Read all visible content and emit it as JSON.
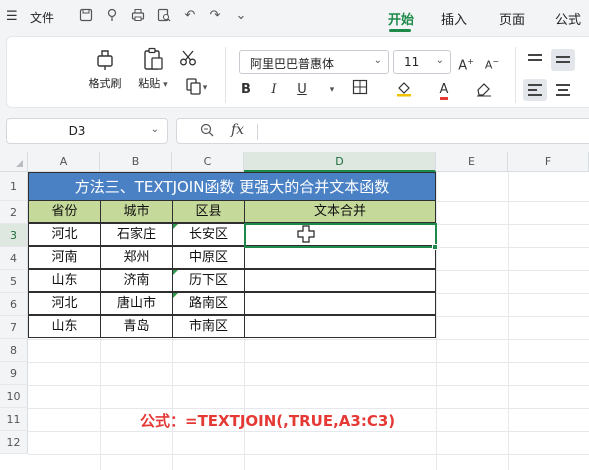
{
  "menubar": {
    "file_label": "文件",
    "tabs": [
      {
        "label": "开始",
        "active": true
      },
      {
        "label": "插入",
        "active": false
      },
      {
        "label": "页面",
        "active": false
      },
      {
        "label": "公式",
        "active": false
      }
    ],
    "accent_color": "#1e8a4a"
  },
  "ribbon": {
    "format_painter_label": "格式刷",
    "paste_label": "粘贴",
    "font_name": "阿里巴巴普惠体",
    "font_size": "11",
    "bold_label": "B",
    "italic_label": "I",
    "underline_label": "U"
  },
  "formula_bar": {
    "name_box": "D3",
    "fx_label": "fx",
    "formula": ""
  },
  "grid": {
    "columns": [
      "A",
      "B",
      "C",
      "D",
      "E",
      "F"
    ],
    "selected_column": "D",
    "rows": [
      "1",
      "2",
      "3",
      "4",
      "5",
      "6",
      "7",
      "8",
      "9",
      "10",
      "11",
      "12"
    ],
    "selected_row": "3",
    "title": "方法三、TEXTJOIN函数 更强大的合并文本函数",
    "title_color": "#4a80c4",
    "header_color": "#c5d99a",
    "headers": [
      "省份",
      "城市",
      "区县",
      "文本合并"
    ],
    "data_rows": [
      [
        "河北",
        "石家庄",
        "长安区",
        ""
      ],
      [
        "河南",
        "郑州",
        "中原区",
        ""
      ],
      [
        "山东",
        "济南",
        "历下区",
        ""
      ],
      [
        "河北",
        "唐山市",
        "路南区",
        ""
      ],
      [
        "山东",
        "青岛",
        "市南区",
        ""
      ]
    ],
    "note": "公式：=TEXTJOIN(,TRUE,A3:C3)",
    "note_color": "#e53935"
  }
}
